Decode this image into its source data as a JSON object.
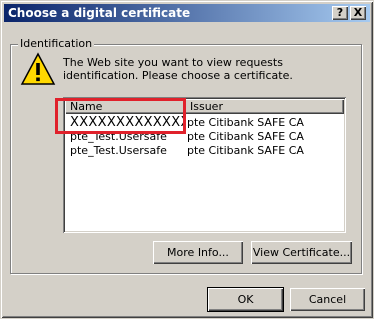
{
  "window": {
    "title": "Choose a digital certificate",
    "help_glyph": "?",
    "close_glyph": "X"
  },
  "group": {
    "label": "Identification",
    "icon": "warning-icon",
    "message": "The Web site you want to view requests identification. Please choose a certificate."
  },
  "list": {
    "columns": [
      "Name",
      "Issuer"
    ],
    "rows": [
      {
        "name": "XXXXXXXXXXXXXX",
        "issuer": "pte Citibank SAFE CA"
      },
      {
        "name": "pte_Test.Usersafe",
        "issuer": "pte Citibank SAFE CA"
      },
      {
        "name": "pte_Test.Usersafe",
        "issuer": "pte Citibank SAFE CA"
      }
    ]
  },
  "buttons": {
    "more_info": "More Info...",
    "view_certificate": "View Certificate...",
    "ok": "OK",
    "cancel": "Cancel"
  },
  "colors": {
    "title_gradient_start": "#0a246a",
    "title_gradient_end": "#a6caf0",
    "highlight_box": "#e0212b",
    "dialog_face": "#d4d0c8"
  }
}
